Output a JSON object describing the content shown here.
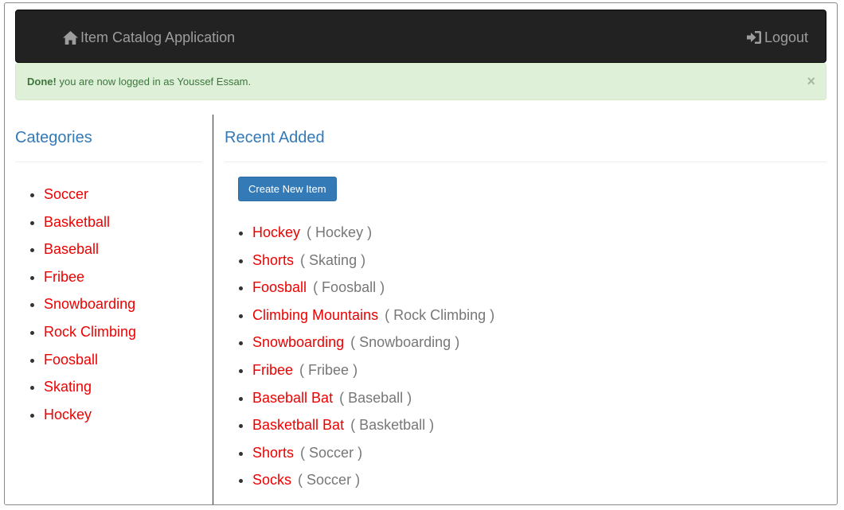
{
  "navbar": {
    "brand_label": "Item Catalog Application",
    "brand_icon": "home-icon",
    "logout_label": "Logout",
    "logout_icon": "log-in-icon"
  },
  "alert": {
    "strong": "Done!",
    "message": "you are now logged in as Youssef Essam.",
    "close": "×"
  },
  "sidebar": {
    "title": "Categories",
    "categories": [
      "Soccer",
      "Basketball",
      "Baseball",
      "Fribee",
      "Snowboarding",
      "Rock Climbing",
      "Foosball",
      "Skating",
      "Hockey"
    ]
  },
  "main": {
    "title": "Recent Added",
    "create_button": "Create New Item",
    "items": [
      {
        "name": "Hockey",
        "category": "( Hockey )"
      },
      {
        "name": "Shorts",
        "category": "( Skating )"
      },
      {
        "name": "Foosball",
        "category": "( Foosball )"
      },
      {
        "name": "Climbing Mountains",
        "category": "( Rock Climbing )"
      },
      {
        "name": "Snowboarding",
        "category": "( Snowboarding )"
      },
      {
        "name": "Fribee",
        "category": "( Fribee )"
      },
      {
        "name": "Baseball Bat",
        "category": "( Baseball )"
      },
      {
        "name": "Basketball Bat",
        "category": "( Basketball )"
      },
      {
        "name": "Shorts",
        "category": "( Soccer )"
      },
      {
        "name": "Socks",
        "category": "( Soccer )"
      }
    ]
  },
  "colors": {
    "navbar_bg": "#222222",
    "nav_text": "#9d9d9d",
    "link_red": "#ee0000",
    "heading_blue": "#337ab7",
    "alert_bg": "#dff0d8",
    "alert_text": "#3c763d",
    "button_blue": "#337ab7"
  }
}
